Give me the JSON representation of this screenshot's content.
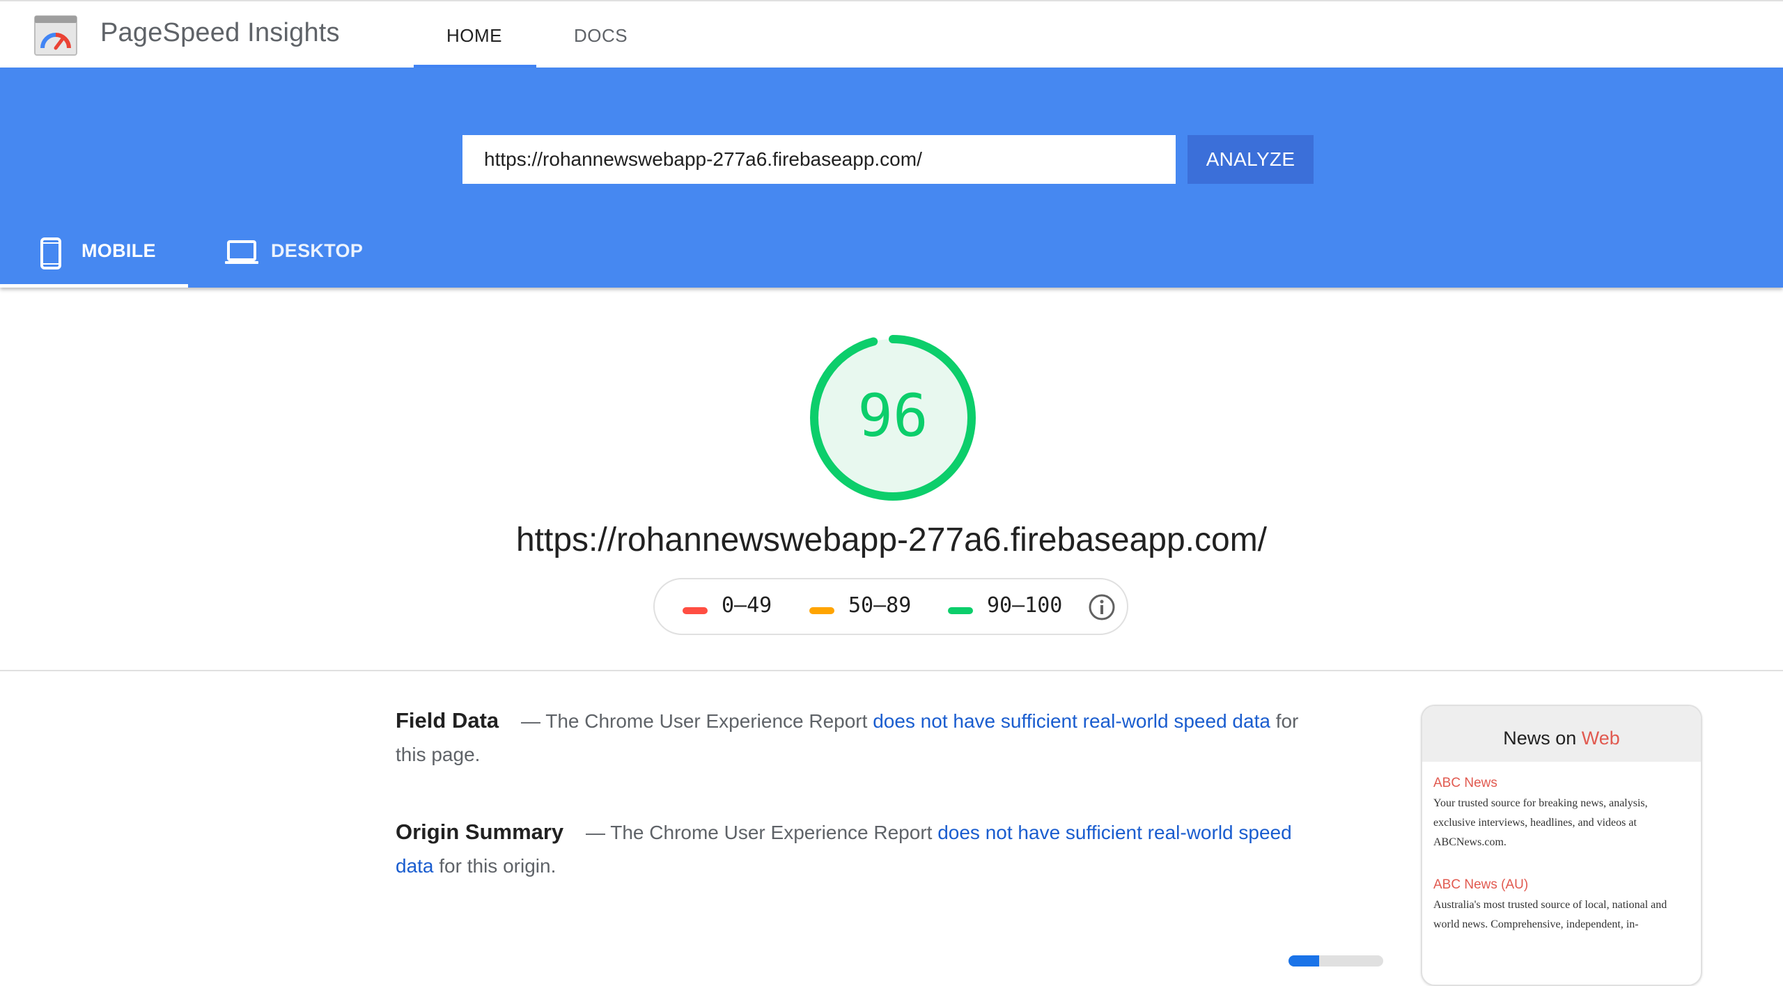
{
  "header": {
    "app_title": "PageSpeed Insights",
    "nav": {
      "home": "HOME",
      "docs": "DOCS"
    },
    "active_nav": "HOME"
  },
  "search": {
    "url_value": "https://rohannewswebapp-277a6.firebaseapp.com/",
    "analyze_label": "ANALYZE"
  },
  "device_tabs": {
    "mobile": "MOBILE",
    "desktop": "DESKTOP",
    "active": "MOBILE"
  },
  "score": {
    "value": "96",
    "fraction": 0.96,
    "url": "https://rohannewswebapp-277a6.firebaseapp.com/",
    "color": "#0cce6b",
    "track_color": "#e8f8ef"
  },
  "legend": [
    {
      "label": "0–49",
      "color": "#ff4e42"
    },
    {
      "label": "50–89",
      "color": "#ffa400"
    },
    {
      "label": "90–100",
      "color": "#0cce6b"
    }
  ],
  "field_data": {
    "heading": "Field Data",
    "text_before": "— The Chrome User Experience Report",
    "link": "does not have sufficient real-world speed data",
    "text_after": "for this page."
  },
  "origin_summary": {
    "heading": "Origin Summary",
    "text_before": "— The Chrome User Experience Report",
    "link": "does not have sufficient real-world speed data",
    "text_after": "for this origin."
  },
  "thumbnail": {
    "title_prefix": "News on ",
    "title_accent": "Web",
    "items": [
      {
        "title": "ABC News",
        "desc": "Your trusted source for breaking news, analysis, exclusive interviews, headlines, and videos at ABCNews.com."
      },
      {
        "title": "ABC News (AU)",
        "desc": "Australia's most trusted source of local, national and world news. Comprehensive, independent, in-"
      }
    ]
  },
  "colors": {
    "brand_blue": "#4688f1",
    "button_blue": "#3b6fd9",
    "link_blue": "#1a5dcf"
  },
  "toggle": {
    "fraction": 0.32
  }
}
